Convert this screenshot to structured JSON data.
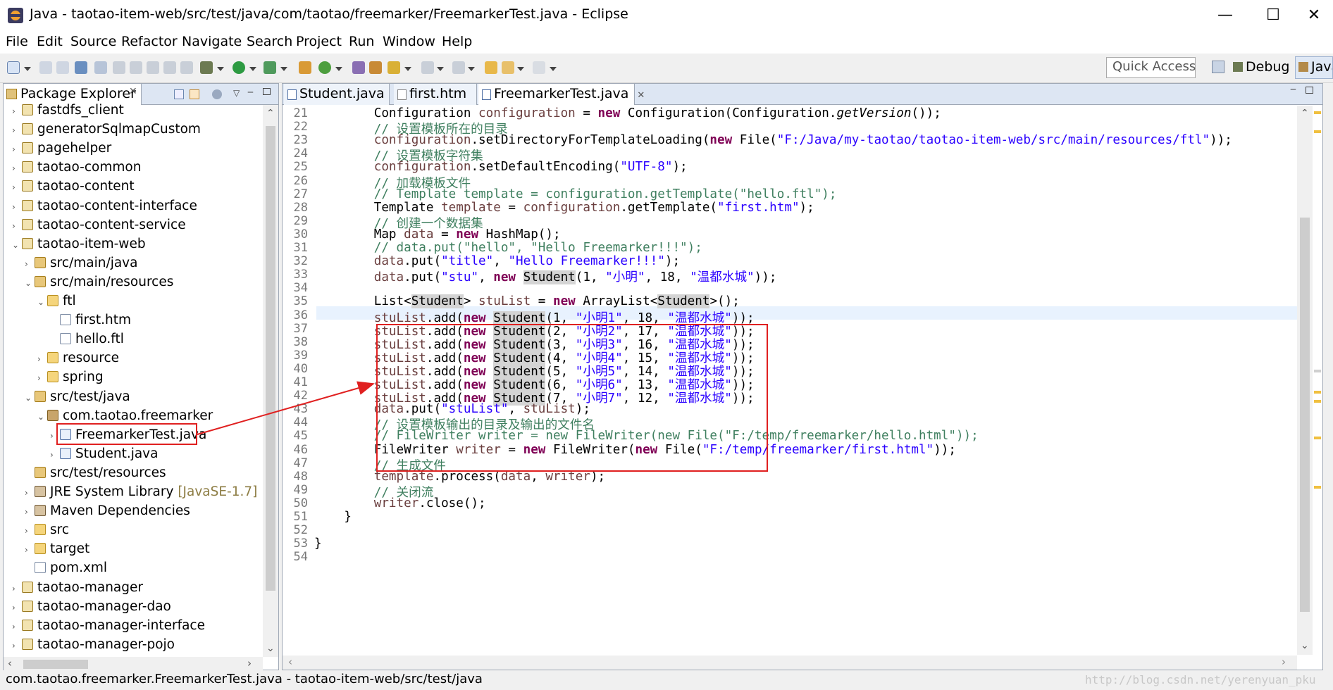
{
  "window": {
    "title": "Java - taotao-item-web/src/test/java/com/taotao/freemarker/FreemarkerTest.java - Eclipse",
    "minimize": "—",
    "maximize": "☐",
    "close": "✕"
  },
  "menu": [
    "File",
    "Edit",
    "Source",
    "Refactor",
    "Navigate",
    "Search",
    "Project",
    "Run",
    "Window",
    "Help"
  ],
  "toolbar": {
    "quick_access": "Quick Access",
    "perspectives": [
      "Debug",
      "Java"
    ]
  },
  "package_explorer": {
    "title": "Package Explorer",
    "tree": [
      {
        "label": "fastdfs_client",
        "indent": 0,
        "arrow": "›",
        "icon": "proj"
      },
      {
        "label": "generatorSqlmapCustom",
        "indent": 0,
        "arrow": "›",
        "icon": "proj"
      },
      {
        "label": "pagehelper",
        "indent": 0,
        "arrow": "›",
        "icon": "proj"
      },
      {
        "label": "taotao-common",
        "indent": 0,
        "arrow": "›",
        "icon": "proj"
      },
      {
        "label": "taotao-content",
        "indent": 0,
        "arrow": "›",
        "icon": "proj"
      },
      {
        "label": "taotao-content-interface",
        "indent": 0,
        "arrow": "›",
        "icon": "proj"
      },
      {
        "label": "taotao-content-service",
        "indent": 0,
        "arrow": "›",
        "icon": "proj"
      },
      {
        "label": "taotao-item-web",
        "indent": 0,
        "arrow": "⌄",
        "icon": "proj"
      },
      {
        "label": "src/main/java",
        "indent": 1,
        "arrow": "›",
        "icon": "pkgfolder"
      },
      {
        "label": "src/main/resources",
        "indent": 1,
        "arrow": "⌄",
        "icon": "pkgfolder"
      },
      {
        "label": "ftl",
        "indent": 2,
        "arrow": "⌄",
        "icon": "folder"
      },
      {
        "label": "first.htm",
        "indent": 3,
        "arrow": "",
        "icon": "file"
      },
      {
        "label": "hello.ftl",
        "indent": 3,
        "arrow": "",
        "icon": "file"
      },
      {
        "label": "resource",
        "indent": 2,
        "arrow": "›",
        "icon": "folder"
      },
      {
        "label": "spring",
        "indent": 2,
        "arrow": "›",
        "icon": "folder"
      },
      {
        "label": "src/test/java",
        "indent": 1,
        "arrow": "⌄",
        "icon": "pkgfolder"
      },
      {
        "label": "com.taotao.freemarker",
        "indent": 2,
        "arrow": "⌄",
        "icon": "pkg"
      },
      {
        "label": "FreemarkerTest.java",
        "indent": 3,
        "arrow": "›",
        "icon": "java"
      },
      {
        "label": "Student.java",
        "indent": 3,
        "arrow": "›",
        "icon": "java"
      },
      {
        "label": "src/test/resources",
        "indent": 1,
        "arrow": "",
        "icon": "pkgfolder"
      },
      {
        "label": "JRE System Library",
        "suffix": "[JavaSE-1.7]",
        "indent": 1,
        "arrow": "›",
        "icon": "lib"
      },
      {
        "label": "Maven Dependencies",
        "indent": 1,
        "arrow": "›",
        "icon": "lib"
      },
      {
        "label": "src",
        "indent": 1,
        "arrow": "›",
        "icon": "folder"
      },
      {
        "label": "target",
        "indent": 1,
        "arrow": "›",
        "icon": "folder"
      },
      {
        "label": "pom.xml",
        "indent": 1,
        "arrow": "",
        "icon": "file"
      },
      {
        "label": "taotao-manager",
        "indent": 0,
        "arrow": "›",
        "icon": "proj"
      },
      {
        "label": "taotao-manager-dao",
        "indent": 0,
        "arrow": "›",
        "icon": "proj"
      },
      {
        "label": "taotao-manager-interface",
        "indent": 0,
        "arrow": "›",
        "icon": "proj"
      },
      {
        "label": "taotao-manager-pojo",
        "indent": 0,
        "arrow": "›",
        "icon": "proj"
      }
    ]
  },
  "editor": {
    "tabs": [
      "Student.java",
      "first.htm",
      "FreemarkerTest.java"
    ],
    "active_tab": "FreemarkerTest.java",
    "lines": [
      {
        "n": "21",
        "html": "        Configuration <span class='var'>configuration</span> = <span class='kw'>new</span> Configuration(Configuration.<span class='ital'>getVersion</span>());"
      },
      {
        "n": "22",
        "html": "        <span class='cmt'>// 设置模板所在的目录</span>"
      },
      {
        "n": "23",
        "html": "        <span class='var'>configuration</span>.setDirectoryForTemplateLoading(<span class='kw'>new</span> File(<span class='str'>\"F:/Java/my-taotao/taotao-item-web/src/main/resources/ftl\"</span>));"
      },
      {
        "n": "24",
        "html": "        <span class='cmt'>// 设置模板字符集</span>"
      },
      {
        "n": "25",
        "html": "        <span class='var'>configuration</span>.setDefaultEncoding(<span class='str'>\"UTF-8\"</span>);"
      },
      {
        "n": "26",
        "html": "        <span class='cmt'>// 加载模板文件</span>"
      },
      {
        "n": "27",
        "html": "        <span class='cmt'>// Template template = configuration.getTemplate(\"hello.ftl\");</span>"
      },
      {
        "n": "28",
        "html": "        Template <span class='var'>template</span> = <span class='var'>configuration</span>.getTemplate(<span class='str'>\"first.htm\"</span>);"
      },
      {
        "n": "29",
        "html": "        <span class='cmt'>// 创建一个数据集</span>"
      },
      {
        "n": "30",
        "html": "        Map <span class='var'>data</span> = <span class='kw'>new</span> HashMap();"
      },
      {
        "n": "31",
        "html": "        <span class='cmt'>// data.put(\"hello\", \"Hello Freemarker!!!\");</span>"
      },
      {
        "n": "32",
        "html": "        <span class='var'>data</span>.put(<span class='str'>\"title\"</span>, <span class='str'>\"Hello Freemarker!!!\"</span>);"
      },
      {
        "n": "33",
        "html": "        <span class='var'>data</span>.put(<span class='str'>\"stu\"</span>, <span class='kw'>new</span> <span class='hl'>Student</span>(1, <span class='str'>\"小明\"</span>, 18, <span class='str'>\"温都水城\"</span>));"
      },
      {
        "n": "34",
        "html": ""
      },
      {
        "n": "35",
        "html": "        List&lt;<span class='hl'>Student</span>&gt; <span class='var'>stuList</span> = <span class='kw'>new</span> ArrayList&lt;<span class='hl'>Student</span>&gt;();"
      },
      {
        "n": "36",
        "html": "        <span class='var'>stuList</span>.add(<span class='kw'>new</span> <span class='hl'>Student</span>(1, <span class='str'>\"小明1\"</span>, 18, <span class='str'>\"温都水城\"</span>));"
      },
      {
        "n": "37",
        "html": "        <span class='var'>stuList</span>.add(<span class='kw'>new</span> <span class='hl'>Student</span>(2, <span class='str'>\"小明2\"</span>, 17, <span class='str'>\"温都水城\"</span>));"
      },
      {
        "n": "38",
        "html": "        <span class='var'>stuList</span>.add(<span class='kw'>new</span> <span class='hl'>Student</span>(3, <span class='str'>\"小明3\"</span>, 16, <span class='str'>\"温都水城\"</span>));"
      },
      {
        "n": "39",
        "html": "        <span class='var'>stuList</span>.add(<span class='kw'>new</span> <span class='hl'>Student</span>(4, <span class='str'>\"小明4\"</span>, 15, <span class='str'>\"温都水城\"</span>));"
      },
      {
        "n": "40",
        "html": "        <span class='var'>stuList</span>.add(<span class='kw'>new</span> <span class='hl'>Student</span>(5, <span class='str'>\"小明5\"</span>, 14, <span class='str'>\"温都水城\"</span>));"
      },
      {
        "n": "41",
        "html": "        <span class='var'>stuList</span>.add(<span class='kw'>new</span> <span class='hl'>Student</span>(6, <span class='str'>\"小明6\"</span>, 13, <span class='str'>\"温都水城\"</span>));"
      },
      {
        "n": "42",
        "html": "        <span class='var'>stuList</span>.add(<span class='kw'>new</span> <span class='hl'>Student</span>(7, <span class='str'>\"小明7\"</span>, 12, <span class='str'>\"温都水城\"</span>));"
      },
      {
        "n": "43",
        "html": "        <span class='var'>data</span>.put(<span class='str'>\"stuList\"</span>, <span class='var'>stuList</span>);"
      },
      {
        "n": "44",
        "html": "        <span class='cmt'>// 设置模板输出的目录及输出的文件名</span>"
      },
      {
        "n": "45",
        "html": "        <span class='cmt'>// FileWriter writer = new FileWriter(new File(\"F:/temp/freemarker/hello.html\"));</span>"
      },
      {
        "n": "46",
        "html": "        FileWriter <span class='var'>writer</span> = <span class='kw'>new</span> FileWriter(<span class='kw'>new</span> File(<span class='str'>\"F:/temp/freemarker/first.html\"</span>));"
      },
      {
        "n": "47",
        "html": "        <span class='cmt'>// 生成文件</span>"
      },
      {
        "n": "48",
        "html": "        <span class='var'>template</span>.process(<span class='var'>data</span>, <span class='var'>writer</span>);"
      },
      {
        "n": "49",
        "html": "        <span class='cmt'>// 关闭流</span>"
      },
      {
        "n": "50",
        "html": "        <span class='var'>writer</span>.close();"
      },
      {
        "n": "51",
        "html": "    }"
      },
      {
        "n": "52",
        "html": ""
      },
      {
        "n": "53",
        "html": "}"
      },
      {
        "n": "54",
        "html": ""
      }
    ]
  },
  "status": {
    "text": "com.taotao.freemarker.FreemarkerTest.java - taotao-item-web/src/test/java",
    "watermark": "http://blog.csdn.net/yerenyuan_pku"
  },
  "colors": {
    "keyword": "#7f0055",
    "string": "#2a00ff",
    "comment": "#3f7f5f",
    "annotation_red": "#e02020"
  }
}
